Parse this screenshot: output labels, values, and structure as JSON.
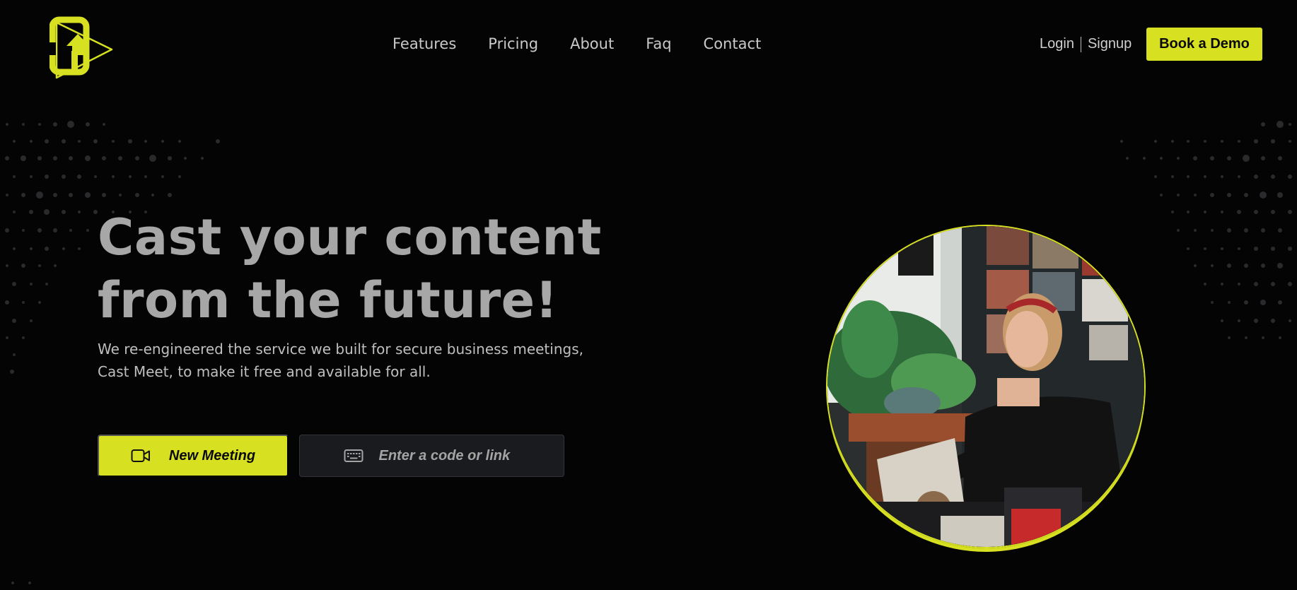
{
  "brand": {
    "logo_icon": "cast-upload-logo-icon",
    "accent": "#d7e021",
    "background": "#040405"
  },
  "nav": {
    "items": [
      {
        "label": "Features"
      },
      {
        "label": "Pricing"
      },
      {
        "label": "About"
      },
      {
        "label": "Faq"
      },
      {
        "label": "Contact"
      }
    ]
  },
  "auth": {
    "login_label": "Login",
    "signup_label": "Signup"
  },
  "header": {
    "demo_label": "Book a Demo"
  },
  "hero": {
    "headline_line1": "Cast your content",
    "headline_line2": "from the future!",
    "subtitle_line1": "We re-engineered the service we built for secure business meetings,",
    "subtitle_line2": "Cast Meet, to make it free and available for all.",
    "new_meeting_label": "New Meeting",
    "new_meeting_icon": "video-camera-icon",
    "code_placeholder": "Enter a code or link",
    "code_value": "",
    "code_icon": "keyboard-icon",
    "photo_subject": "woman-browsing-vinyl-records-photo"
  }
}
